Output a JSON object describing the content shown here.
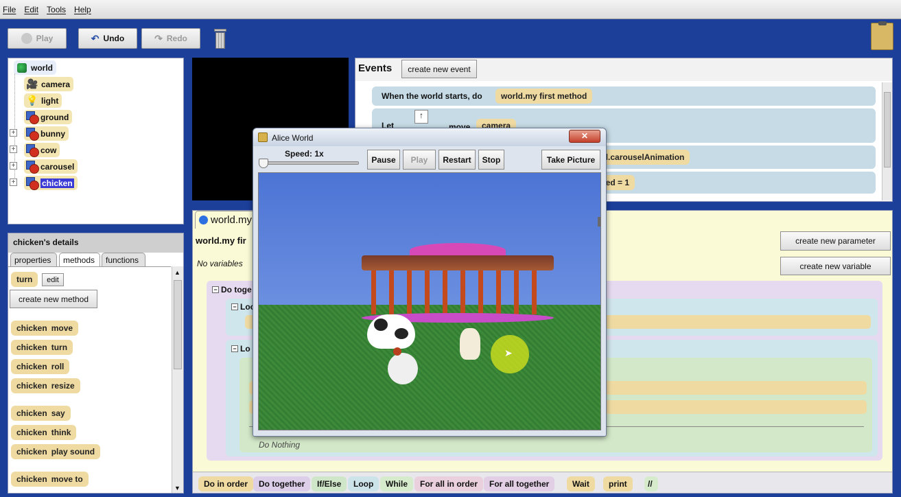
{
  "menu": [
    "File",
    "Edit",
    "Tools",
    "Help"
  ],
  "toolbar": {
    "play": "Play",
    "undo": "Undo",
    "redo": "Redo"
  },
  "tree": {
    "items": [
      "world",
      "camera",
      "light",
      "ground",
      "bunny",
      "cow",
      "carousel",
      "chicken"
    ],
    "selected": "chicken"
  },
  "details": {
    "title": "chicken's details",
    "tabs": [
      "properties",
      "methods",
      "functions"
    ],
    "active_tab": "methods",
    "method_turn": "turn",
    "edit": "edit",
    "create_method": "create new method",
    "tiles": [
      {
        "obj": "chicken",
        "verb": "move"
      },
      {
        "obj": "chicken",
        "verb": "turn"
      },
      {
        "obj": "chicken",
        "verb": "roll"
      },
      {
        "obj": "chicken",
        "verb": "resize"
      },
      {
        "obj": "chicken",
        "verb": "say"
      },
      {
        "obj": "chicken",
        "verb": "think"
      },
      {
        "obj": "chicken",
        "verb": "play sound"
      },
      {
        "obj": "chicken",
        "verb": "move to"
      }
    ]
  },
  "events": {
    "title": "Events",
    "create_event": "create new event",
    "when": "When the world starts, do",
    "method": "world.my first method",
    "let": "Let",
    "move": "move",
    "camera": "camera",
    "carousel_anim": "el.carouselAnimation",
    "speed": "eed = 1"
  },
  "editor": {
    "tab_world": "world.my",
    "tab_first": "first method",
    "method_label": "world.my fir",
    "no_variables": "No variables",
    "create_param": "create new parameter",
    "create_var": "create new variable",
    "do_together": "Do toge",
    "loop1": "Loo",
    "loop2": "Lo",
    "do_nothing": "Do Nothing"
  },
  "alice": {
    "title": "Alice World",
    "speed": "Speed: 1x",
    "pause": "Pause",
    "play": "Play",
    "restart": "Restart",
    "stop": "Stop",
    "take_picture": "Take Picture"
  },
  "bottom": [
    {
      "label": "Do in order",
      "color": "#efdba2"
    },
    {
      "label": "Do together",
      "color": "#dccde8"
    },
    {
      "label": "If/Else",
      "color": "#cfe6c9"
    },
    {
      "label": "Loop",
      "color": "#cde3ea"
    },
    {
      "label": "While",
      "color": "#d6ebcc"
    },
    {
      "label": "For all in order",
      "color": "#ead0dc"
    },
    {
      "label": "For all together",
      "color": "#e2cfe6"
    },
    {
      "label": "Wait",
      "color": "#efdba2"
    },
    {
      "label": "print",
      "color": "#efdba2"
    }
  ],
  "colors": {
    "background": "#1c3f9a",
    "tile": "#efdba2",
    "sky": "#4a74d6",
    "grass": "#3b8a3a"
  }
}
